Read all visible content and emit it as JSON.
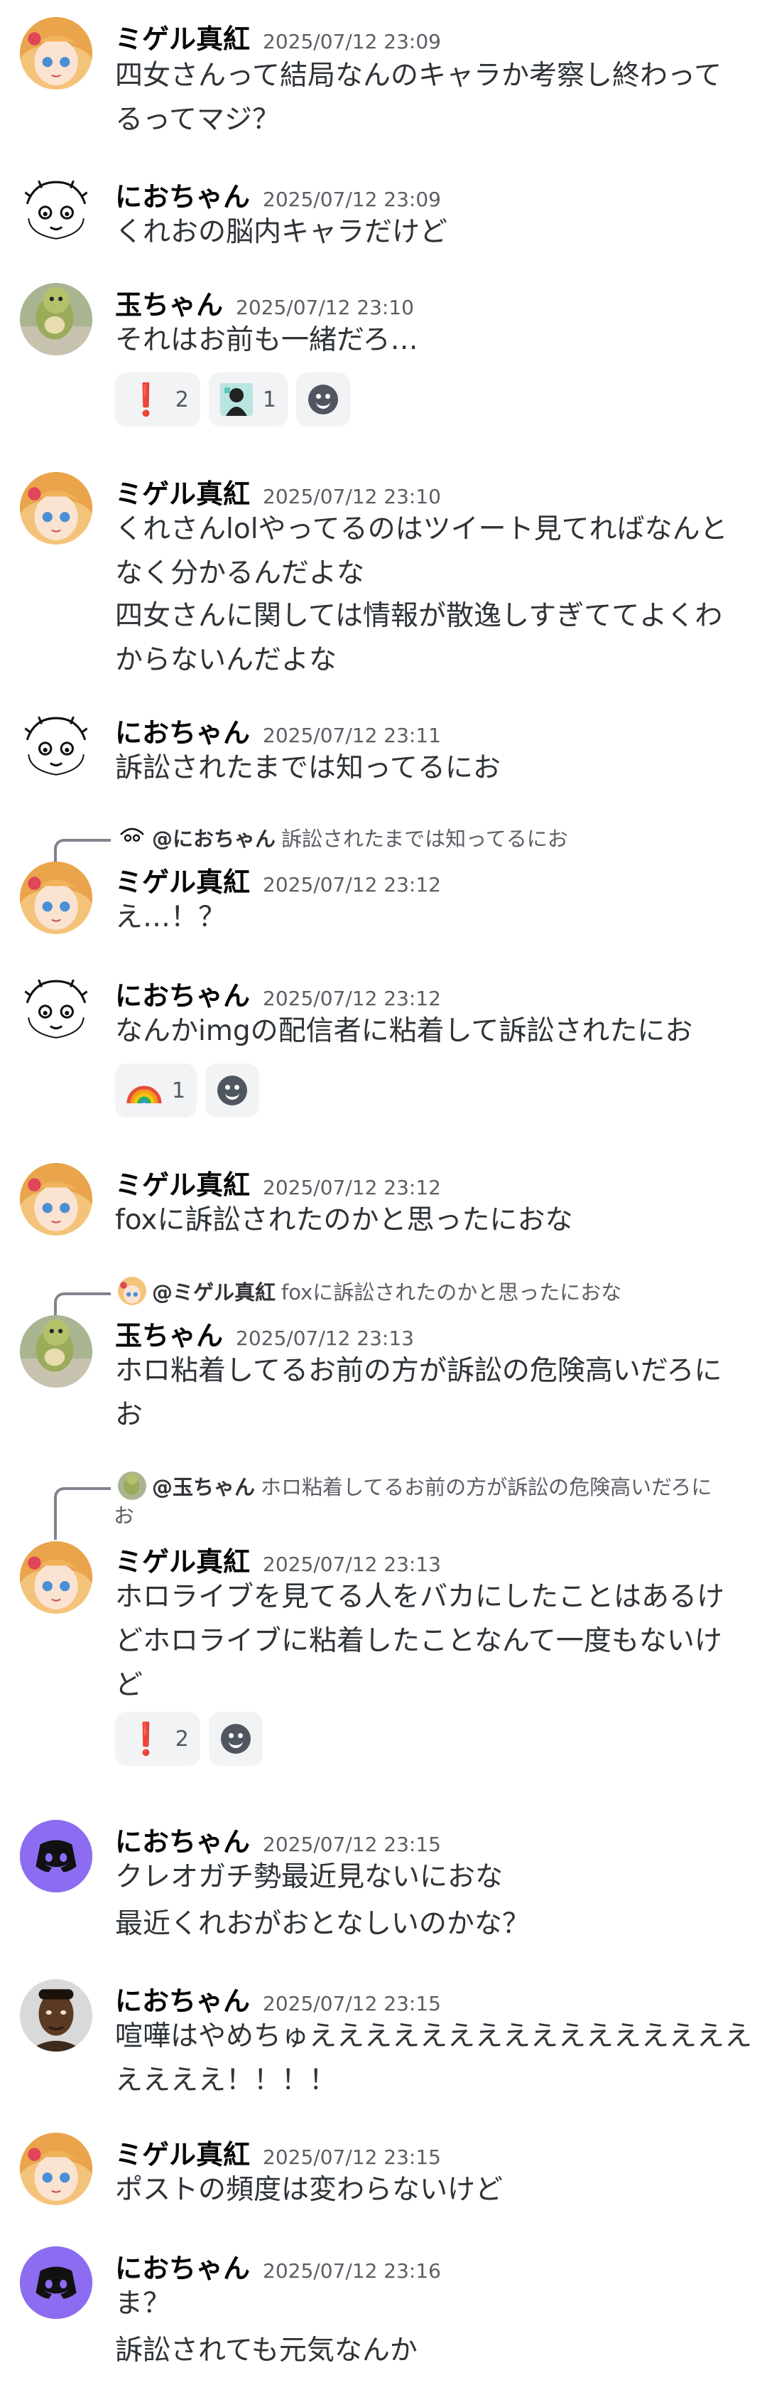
{
  "messages": [
    {
      "author": "ミゲル真紅",
      "timestamp": "2025/07/12 23:09",
      "avatar": "anime-girl-avatar",
      "lines": [
        "四女さんって結局なんのキャラか考察し終わって\nるってマジ？"
      ]
    },
    {
      "author": "におちゃん",
      "timestamp": "2025/07/12 23:09",
      "avatar": "sketch-face-avatar",
      "lines": [
        "くれおの脳内キャラだけど"
      ]
    },
    {
      "author": "玉ちゃん",
      "timestamp": "2025/07/12 23:10",
      "avatar": "green-plush-avatar",
      "lines": [
        "それはお前も一緒だろ…"
      ],
      "reactions": [
        {
          "icon": "exclamation-icon",
          "count": "2"
        },
        {
          "icon": "character-emoji-icon",
          "count": "1"
        }
      ]
    },
    {
      "author": "ミゲル真紅",
      "timestamp": "2025/07/12 23:10",
      "avatar": "anime-girl-avatar",
      "lines": [
        "くれさんlolやってるのはツイート見てればなんと\nなく分かるんだよな",
        "四女さんに関しては情報が散逸しすぎててよくわ\nからないんだよな"
      ]
    },
    {
      "author": "におちゃん",
      "timestamp": "2025/07/12 23:11",
      "avatar": "sketch-face-avatar",
      "lines": [
        "訴訟されたまでは知ってるにお"
      ]
    },
    {
      "author": "ミゲル真紅",
      "timestamp": "2025/07/12 23:12",
      "avatar": "anime-girl-avatar",
      "reply": {
        "name": "@におちゃん",
        "text": "訴訟されたまでは知ってるにお",
        "avatar": "sketch-face-avatar"
      },
      "lines": [
        "え…！？"
      ]
    },
    {
      "author": "におちゃん",
      "timestamp": "2025/07/12 23:12",
      "avatar": "sketch-face-avatar",
      "lines": [
        "なんかimgの配信者に粘着して訴訟されたにお"
      ],
      "reactions": [
        {
          "icon": "rainbow-icon",
          "count": "1"
        }
      ]
    },
    {
      "author": "ミゲル真紅",
      "timestamp": "2025/07/12 23:12",
      "avatar": "anime-girl-avatar",
      "lines": [
        "foxに訴訟されたのかと思ったにおな"
      ]
    },
    {
      "author": "玉ちゃん",
      "timestamp": "2025/07/12 23:13",
      "avatar": "green-plush-avatar",
      "reply": {
        "name": "@ミゲル真紅",
        "text": "foxに訴訟されたのかと思ったにおな",
        "avatar": "anime-girl-avatar"
      },
      "lines": [
        "ホロ粘着してるお前の方が訴訟の危険高いだろに\nお"
      ]
    },
    {
      "author": "ミゲル真紅",
      "timestamp": "2025/07/12 23:13",
      "avatar": "anime-girl-avatar",
      "reply": {
        "name": "@玉ちゃん",
        "text": "ホロ粘着してるお前の方が訴訟の危険高いだろに",
        "text2": "お",
        "avatar": "green-plush-avatar"
      },
      "lines": [
        "ホロライブを見てる人をバカにしたことはあるけ\nどホロライブに粘着したことなんて一度もないけ\nど"
      ],
      "reactions": [
        {
          "icon": "exclamation-icon",
          "count": "2"
        }
      ]
    },
    {
      "author": "におちゃん",
      "timestamp": "2025/07/12 23:15",
      "avatar": "default-discord-avatar",
      "lines": [
        "クレオガチ勢最近見ないにおな",
        "最近くれおがおとなしいのかな？"
      ]
    },
    {
      "author": "におちゃん",
      "timestamp": "2025/07/12 23:15",
      "avatar": "photo-man-avatar",
      "lines": [
        "喧嘩はやめちゅええええええええええええええええ\nええええ！！！！"
      ]
    },
    {
      "author": "ミゲル真紅",
      "timestamp": "2025/07/12 23:15",
      "avatar": "anime-girl-avatar",
      "lines": [
        "ポストの頻度は変わらないけど"
      ]
    },
    {
      "author": "におちゃん",
      "timestamp": "2025/07/12 23:16",
      "avatar": "default-discord-avatar",
      "lines": [
        "ま？",
        "訴訟されても元気なんか"
      ]
    }
  ],
  "colors": {
    "author": "#060607",
    "text": "#2e3338",
    "muted": "#5c5e66",
    "reaction_bg": "#f2f3f5",
    "blurple": "#8c6cf0"
  }
}
